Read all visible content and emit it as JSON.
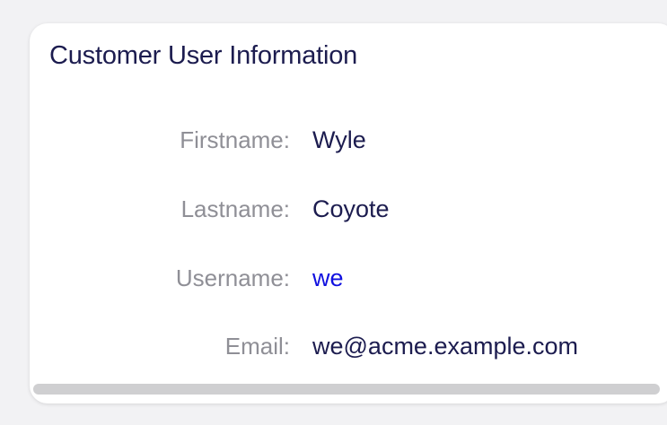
{
  "widget": {
    "title": "Customer User Information"
  },
  "fields": [
    {
      "label": "Firstname:",
      "value": "Wyle"
    },
    {
      "label": "Lastname:",
      "value": "Coyote"
    },
    {
      "label": "Username:",
      "value": "we"
    },
    {
      "label": "Email:",
      "value": "we@acme.example.com"
    }
  ],
  "colors": {
    "title": "#1c1c4f",
    "label": "#8f8f96",
    "value": "#1c1c4f",
    "link": "#1010e0",
    "background": "#f2f2f4",
    "card": "#ffffff",
    "scrollbar": "#cfcfd1"
  }
}
